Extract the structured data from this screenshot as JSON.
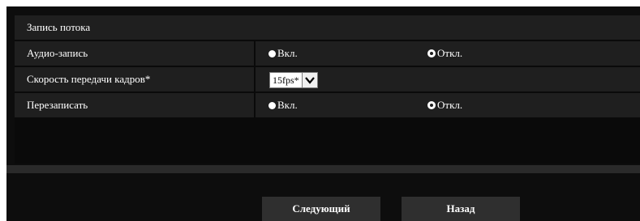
{
  "section": {
    "title": "Запись потока"
  },
  "audio_record": {
    "label": "Аудио-запись",
    "options": [
      "Вкл.",
      "Откл."
    ],
    "selected": "Откл."
  },
  "frame_rate": {
    "label": "Скорость передачи кадров*",
    "value": "15fps*"
  },
  "overwrite": {
    "label": "Перезаписать",
    "options": [
      "Вкл.",
      "Откл."
    ],
    "selected": "Откл."
  },
  "buttons": {
    "next": "Следующий",
    "back": "Назад"
  },
  "colors": {
    "background": "#0d0d0d",
    "row": "#1f1f1f",
    "button": "#2f2f2f"
  }
}
